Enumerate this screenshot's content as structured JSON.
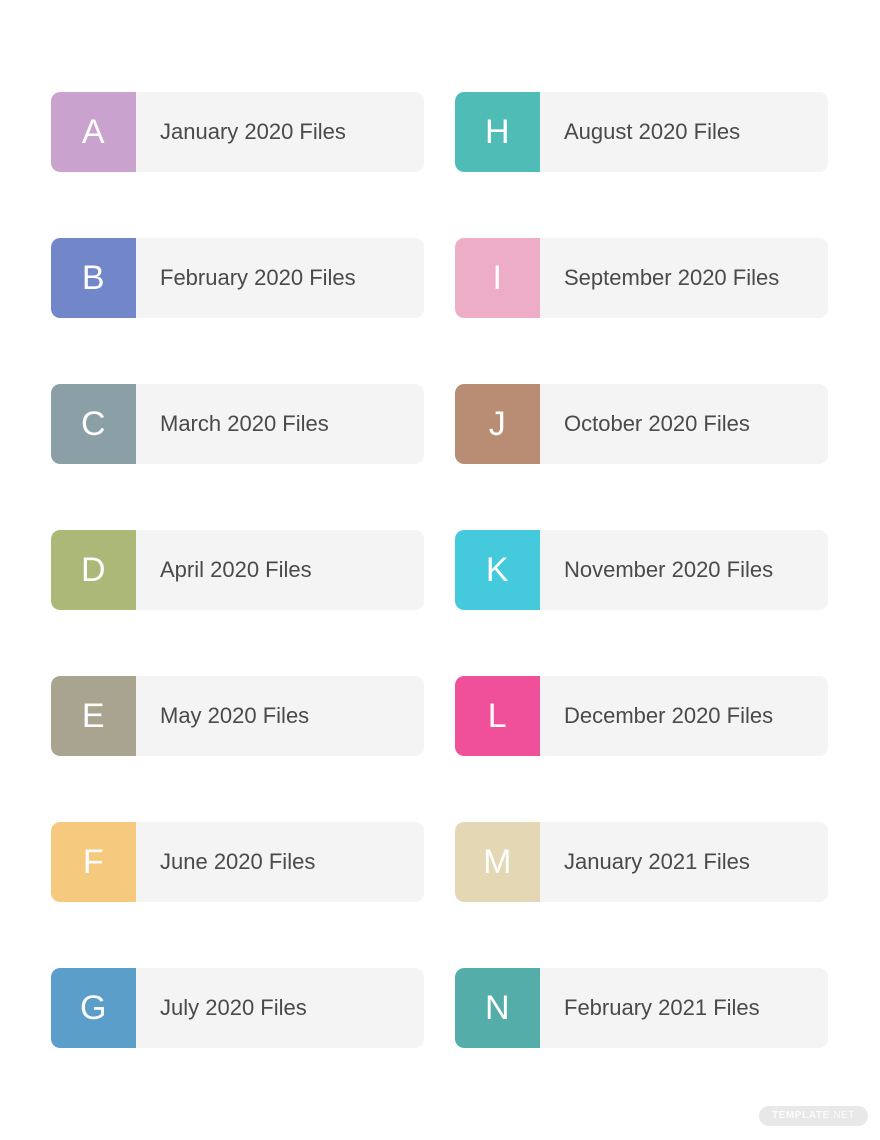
{
  "page": {
    "background_color": "#ffffff",
    "card_body_color": "#f4f4f4",
    "card_text_color": "#4a4a4a",
    "letter_text_color": "#fdfdfd"
  },
  "columns": [
    {
      "id": "left",
      "cards": [
        {
          "letter": "A",
          "title": "January 2020 Files",
          "color": "#c9a3ce"
        },
        {
          "letter": "B",
          "title": "February 2020 Files",
          "color": "#7287c9"
        },
        {
          "letter": "C",
          "title": "March 2020 Files",
          "color": "#8ba0a6"
        },
        {
          "letter": "D",
          "title": "April 2020 Files",
          "color": "#acb878"
        },
        {
          "letter": "E",
          "title": "May 2020 Files",
          "color": "#a9a490"
        },
        {
          "letter": "F",
          "title": "June 2020 Files",
          "color": "#f5c97e"
        },
        {
          "letter": "G",
          "title": "July 2020 Files",
          "color": "#5b9ec9"
        }
      ]
    },
    {
      "id": "right",
      "cards": [
        {
          "letter": "H",
          "title": "August 2020 Files",
          "color": "#4fbcb5"
        },
        {
          "letter": "I",
          "title": "September 2020 Files",
          "color": "#eeadc6"
        },
        {
          "letter": "J",
          "title": "October 2020 Files",
          "color": "#b98c74"
        },
        {
          "letter": "K",
          "title": "November 2020 Files",
          "color": "#45cadd"
        },
        {
          "letter": "L",
          "title": "December 2020 Files",
          "color": "#f0509a"
        },
        {
          "letter": "M",
          "title": "January 2021 Files",
          "color": "#e4d7b4"
        },
        {
          "letter": "N",
          "title": "February 2021 Files",
          "color": "#55ada9"
        }
      ]
    }
  ],
  "watermark": {
    "strong_text": "TEMPLATE",
    "light_text": ".NET",
    "background_color": "#e8e8e8",
    "text_color": "#fbfbfb"
  }
}
